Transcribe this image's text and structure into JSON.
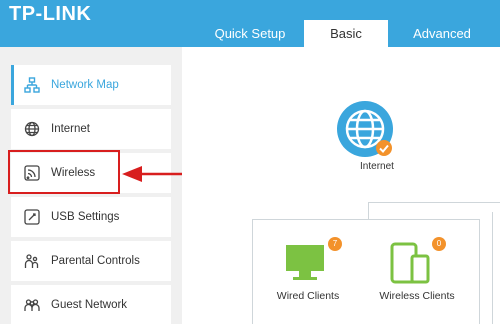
{
  "header": {
    "logo": "TP-LINK",
    "tabs": [
      "Quick Setup",
      "Basic",
      "Advanced"
    ],
    "active_tab": "Basic"
  },
  "sidebar": {
    "items": [
      {
        "label": "Network Map",
        "icon": "network-map-icon",
        "active": true
      },
      {
        "label": "Internet",
        "icon": "globe-icon",
        "active": false
      },
      {
        "label": "Wireless",
        "icon": "wireless-icon",
        "active": false
      },
      {
        "label": "USB Settings",
        "icon": "usb-icon",
        "active": false
      },
      {
        "label": "Parental Controls",
        "icon": "parental-icon",
        "active": false
      },
      {
        "label": "Guest Network",
        "icon": "guest-icon",
        "active": false
      }
    ]
  },
  "main": {
    "internet": {
      "label": "Internet",
      "status_icon": "check-icon"
    },
    "wired_clients": {
      "label": "Wired Clients",
      "count": "7"
    },
    "wireless_clients": {
      "label": "Wireless Clients",
      "count": "0"
    }
  },
  "colors": {
    "accent": "#3aa6dd",
    "client_green": "#7cc242",
    "badge_orange": "#f3922b",
    "highlight_red": "#d81e1e"
  }
}
